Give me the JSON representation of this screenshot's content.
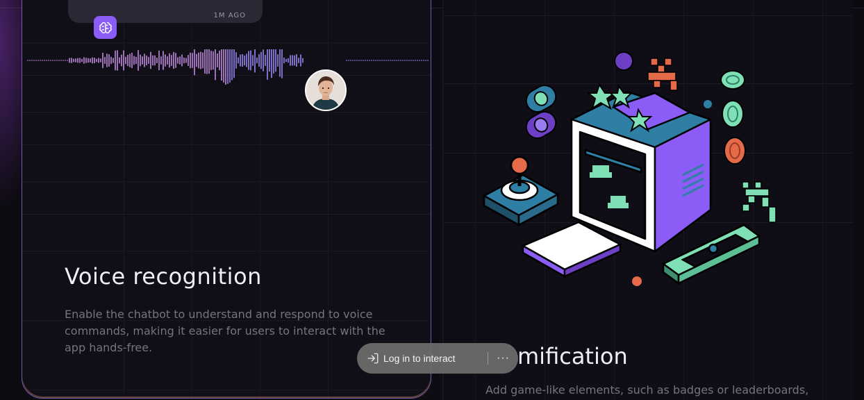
{
  "voice_card": {
    "message_time": "1M AGO",
    "title": "Voice recognition",
    "description": "Enable the chatbot to understand and respond to voice commands, making it easier for users to interact with the app hands-free."
  },
  "game_card": {
    "title": "mification",
    "description": "Add game-like elements, such as badges or leaderboards,"
  },
  "overlay": {
    "login_label": "Log in to interact",
    "more_label": "···"
  },
  "icons": {
    "bot": "brain-icon",
    "login": "log-in-icon",
    "more": "more-horizontal-icon"
  },
  "colors": {
    "accent_purple": "#8b5cf6",
    "wave_purple": "#b98be8",
    "teal": "#2f7fa5",
    "mint": "#7fe0b5",
    "orange": "#e46a4a"
  }
}
